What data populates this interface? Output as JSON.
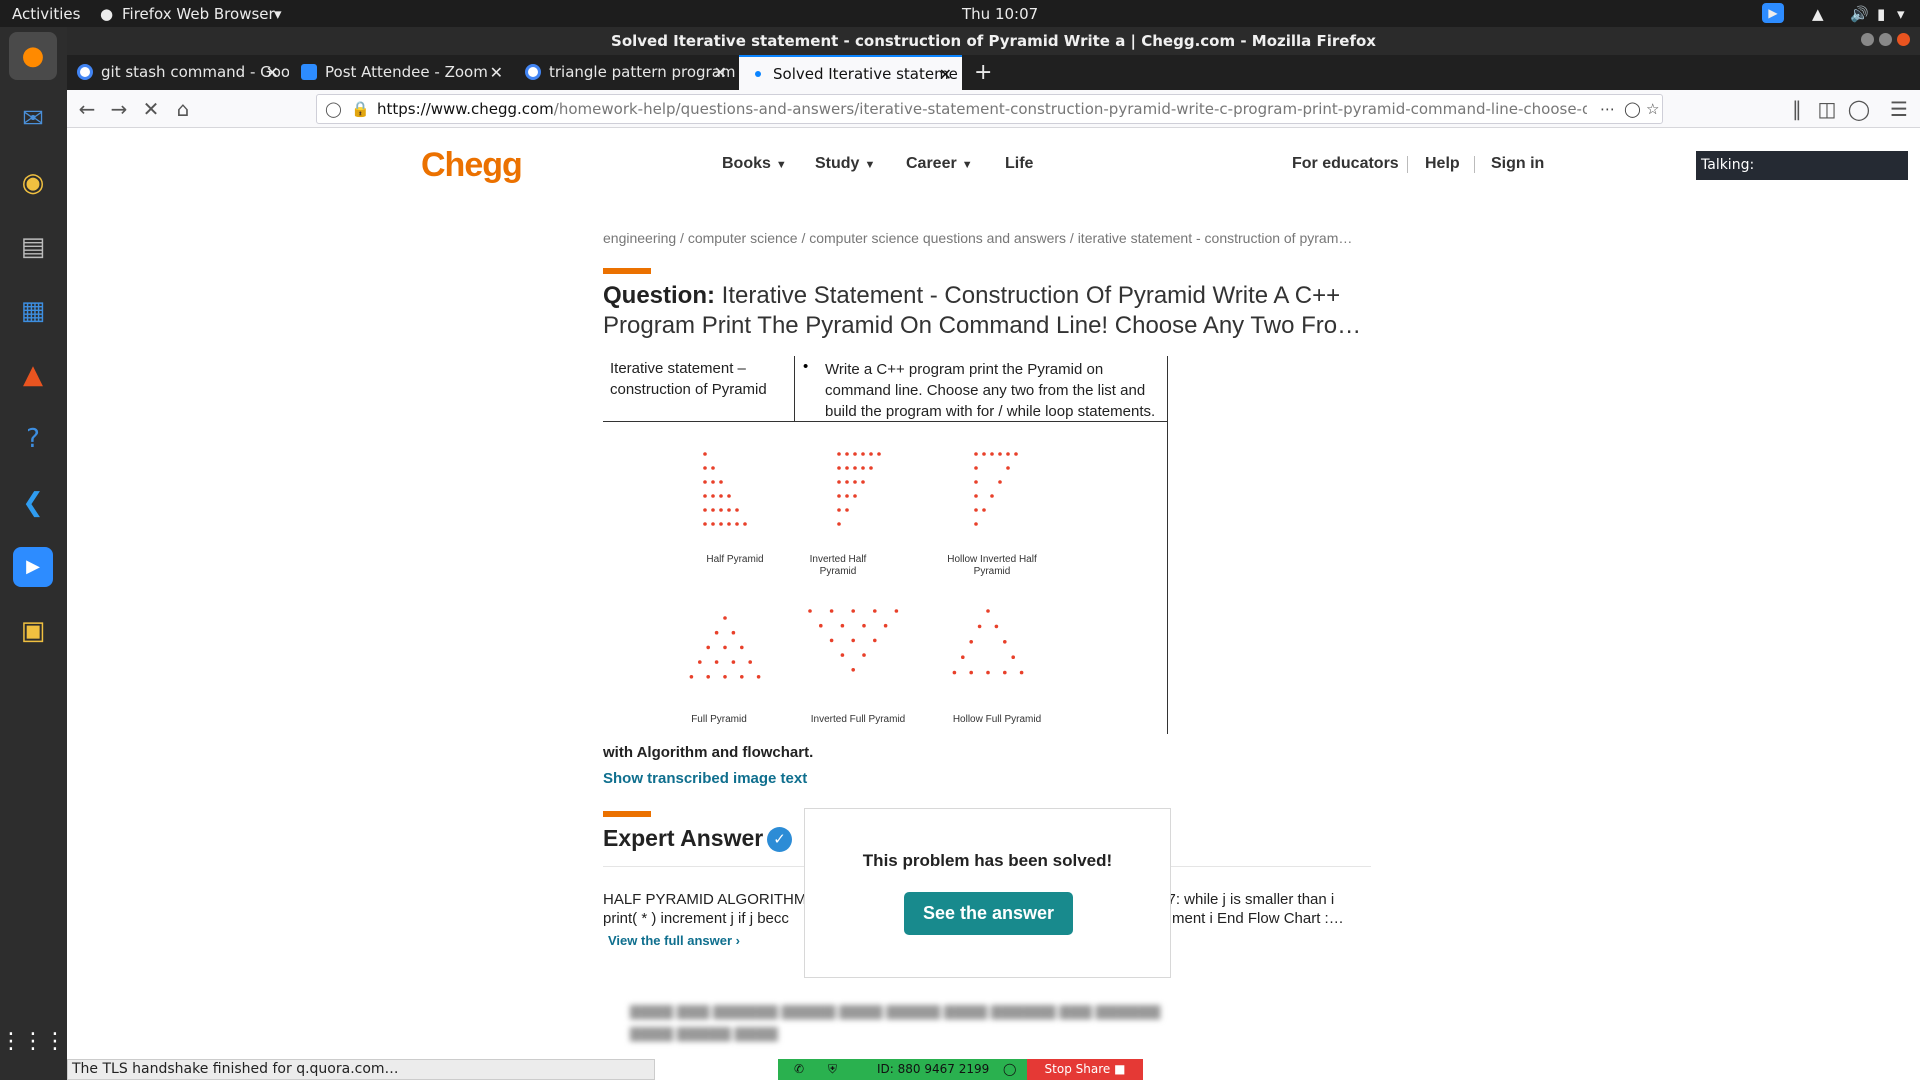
{
  "system": {
    "activities": "Activities",
    "app_menu": "Firefox Web Browser",
    "clock": "Thu 10:07"
  },
  "window": {
    "title": "Solved Iterative statement - construction of Pyramid Write a | Chegg.com - Mozilla Firefox"
  },
  "tabs": [
    {
      "label": "git stash command - Goo",
      "favicon": "google-icon"
    },
    {
      "label": "Post Attendee - Zoom",
      "favicon": "zoom-icon"
    },
    {
      "label": "triangle pattern program",
      "favicon": "google-icon"
    },
    {
      "label": "Solved Iterative stateme",
      "favicon": "loading-dot",
      "active": true
    }
  ],
  "navbar": {
    "url_host": "https://www.chegg.com",
    "url_path": "/homework-help/questions-and-answers/iterative-statement-construction-pyramid-write-c-program-print-pyramid-command-line-choose-q5546270"
  },
  "site": {
    "logo": "Chegg",
    "nav": [
      "Books",
      "Study",
      "Career",
      "Life"
    ],
    "right_nav": [
      "For educators",
      "Help",
      "Sign in"
    ],
    "talking": "Talking:"
  },
  "breadcrumb": "engineering / computer science / computer science questions and answers / iterative statement - construction of pyram…",
  "question": {
    "label": "Question:",
    "title": "Iterative Statement - Construction Of Pyramid Write A C++ Program Print The Pyramid On Command Line! Choose Any Two Fro…"
  },
  "question_image": {
    "left_cell": "Iterative statement – construction of Pyramid",
    "right_cell": "Write a C++ program print the Pyramid on command line. Choose any two from the list and build the program with for / while loop statements.",
    "captions": [
      "Half Pyramid",
      "Inverted Half Pyramid",
      "Hollow Inverted Half Pyramid",
      "Full Pyramid",
      "Inverted Full Pyramid",
      "Hollow Full Pyramid"
    ],
    "dot_color": "#e8402a"
  },
  "with_algorithm": "with Algorithm and flowchart.",
  "show_transcribed": "Show transcribed image text",
  "expert_answer": {
    "heading": "Expert Answer",
    "text_left": "HALF PYRAMID ALGORITHM",
    "text_right": "n 7: while j is smaller than i",
    "text_left2": "print( * ) increment j if j becc",
    "text_right2": "ment i End Flow Chart :…",
    "view_full": "View the full answer"
  },
  "solved_popup": {
    "message": "This problem has been solved!",
    "button": "See the answer"
  },
  "status_text": "The TLS handshake finished for q.quora.com…",
  "zoom": {
    "meeting_id": "ID: 880 9467 2199",
    "stop_share": "Stop Share"
  },
  "colors": {
    "chegg_orange": "#eb7100",
    "link_teal": "#0f6f8e",
    "button_teal": "#188a8d"
  }
}
